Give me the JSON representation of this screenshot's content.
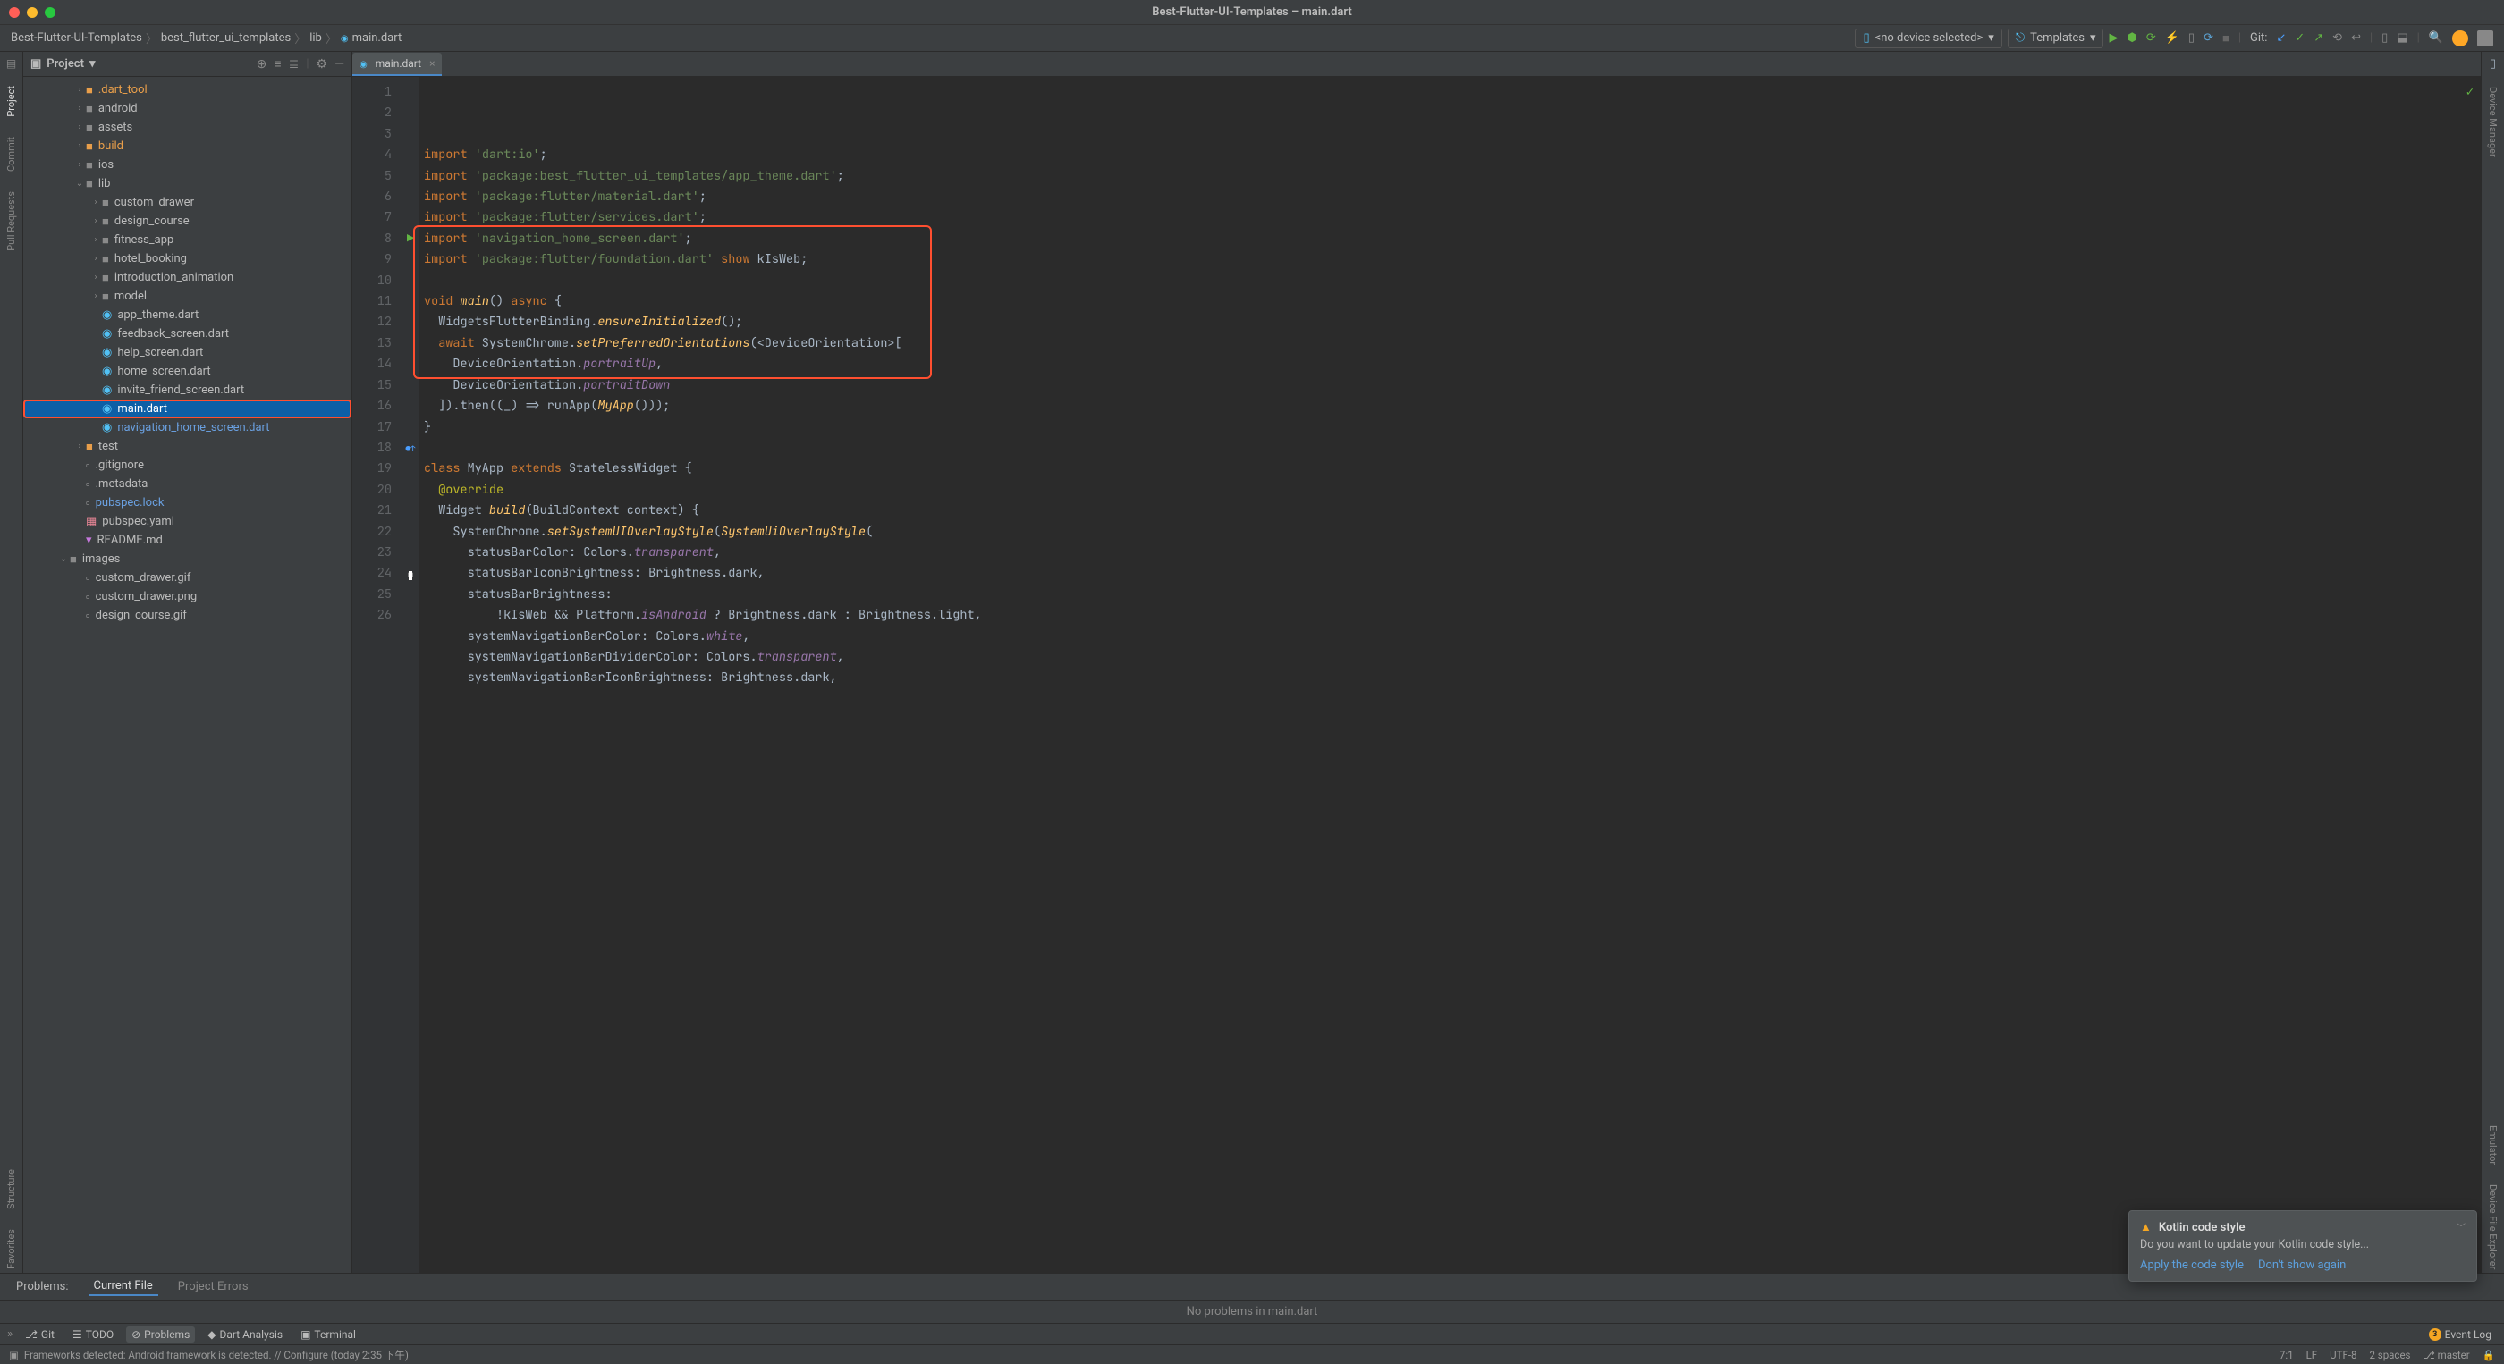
{
  "titlebar": {
    "title": "Best-Flutter-UI-Templates – main.dart"
  },
  "breadcrumb": {
    "items": [
      "Best-Flutter-UI-Templates",
      "best_flutter_ui_templates",
      "lib",
      "main.dart"
    ]
  },
  "device_selector": {
    "label": "<no device selected>"
  },
  "run_config": {
    "label": "Templates"
  },
  "git_label": "Git:",
  "left_tools": {
    "project": "Project",
    "commit": "Commit",
    "pull_requests": "Pull Requests",
    "structure": "Structure",
    "favorites": "Favorites"
  },
  "right_tools": {
    "device_manager": "Device Manager",
    "emulator": "Emulator",
    "device_file_explorer": "Device File Explorer"
  },
  "sidebar": {
    "header": "Project",
    "tree": [
      {
        "depth": 1,
        "chev": ">",
        "icon": "folder",
        "cls": "orange",
        "label": ".dart_tool",
        "lcls": "orange"
      },
      {
        "depth": 1,
        "chev": ">",
        "icon": "folder",
        "label": "android"
      },
      {
        "depth": 1,
        "chev": ">",
        "icon": "folder",
        "label": "assets"
      },
      {
        "depth": 1,
        "chev": ">",
        "icon": "folder",
        "cls": "build",
        "label": "build",
        "lcls": "orange"
      },
      {
        "depth": 1,
        "chev": ">",
        "icon": "folder",
        "label": "ios"
      },
      {
        "depth": 1,
        "chev": "v",
        "icon": "folder",
        "label": "lib"
      },
      {
        "depth": 2,
        "chev": ">",
        "icon": "folder",
        "label": "custom_drawer"
      },
      {
        "depth": 2,
        "chev": ">",
        "icon": "folder",
        "label": "design_course"
      },
      {
        "depth": 2,
        "chev": ">",
        "icon": "folder",
        "label": "fitness_app"
      },
      {
        "depth": 2,
        "chev": ">",
        "icon": "folder",
        "label": "hotel_booking"
      },
      {
        "depth": 2,
        "chev": ">",
        "icon": "folder",
        "label": "introduction_animation"
      },
      {
        "depth": 2,
        "chev": ">",
        "icon": "folder",
        "label": "model"
      },
      {
        "depth": 2,
        "chev": "",
        "icon": "dart",
        "label": "app_theme.dart"
      },
      {
        "depth": 2,
        "chev": "",
        "icon": "dart",
        "label": "feedback_screen.dart"
      },
      {
        "depth": 2,
        "chev": "",
        "icon": "dart",
        "label": "help_screen.dart"
      },
      {
        "depth": 2,
        "chev": "",
        "icon": "dart",
        "label": "home_screen.dart"
      },
      {
        "depth": 2,
        "chev": "",
        "icon": "dart",
        "label": "invite_friend_screen.dart"
      },
      {
        "depth": 2,
        "chev": "",
        "icon": "dart",
        "label": "main.dart",
        "selected": true,
        "hl": true
      },
      {
        "depth": 2,
        "chev": "",
        "icon": "dart",
        "label": "navigation_home_screen.dart",
        "lcls": "blue"
      },
      {
        "depth": 1,
        "chev": ">",
        "icon": "folder",
        "cls": "orange",
        "label": "test"
      },
      {
        "depth": 1,
        "chev": "",
        "icon": "file",
        "label": ".gitignore"
      },
      {
        "depth": 1,
        "chev": "",
        "icon": "file",
        "label": ".metadata"
      },
      {
        "depth": 1,
        "chev": "",
        "icon": "file",
        "label": "pubspec.lock",
        "lcls": "blue"
      },
      {
        "depth": 1,
        "chev": "",
        "icon": "yaml",
        "label": "pubspec.yaml"
      },
      {
        "depth": 1,
        "chev": "",
        "icon": "md",
        "label": "README.md"
      },
      {
        "depth": 0,
        "chev": "v",
        "icon": "folder",
        "label": "images"
      },
      {
        "depth": 1,
        "chev": "",
        "icon": "file",
        "label": "custom_drawer.gif"
      },
      {
        "depth": 1,
        "chev": "",
        "icon": "file",
        "label": "custom_drawer.png"
      },
      {
        "depth": 1,
        "chev": "",
        "icon": "file",
        "label": "design_course.gif"
      }
    ]
  },
  "tab": {
    "label": "main.dart"
  },
  "code_lines": [
    {
      "n": 1,
      "marker": "",
      "html": "<span class='kw'>import</span> <span class='str'>'dart:io'</span>;"
    },
    {
      "n": 2,
      "marker": "",
      "html": "<span class='kw'>import</span> <span class='str'>'package:best_flutter_ui_templates/app_theme.dart'</span>;"
    },
    {
      "n": 3,
      "marker": "",
      "html": "<span class='kw'>import</span> <span class='str'>'package:flutter/material.dart'</span>;"
    },
    {
      "n": 4,
      "marker": "",
      "html": "<span class='kw'>import</span> <span class='str'>'package:flutter/services.dart'</span>;"
    },
    {
      "n": 5,
      "marker": "",
      "html": "<span class='kw'>import</span> <span class='str'>'navigation_home_screen.dart'</span>;"
    },
    {
      "n": 6,
      "marker": "",
      "html": "<span class='kw'>import</span> <span class='str'>'package:flutter/foundation.dart'</span> <span class='kw'>show</span> kIsWeb;"
    },
    {
      "n": 7,
      "marker": "",
      "html": ""
    },
    {
      "n": 8,
      "marker": "▶",
      "html": "<span class='kw'>void</span> <span class='fn'>main</span>() <span class='kw'>async</span> {"
    },
    {
      "n": 9,
      "marker": "",
      "html": "  WidgetsFlutterBinding.<span class='fn-call'>ensureInitialized</span>();"
    },
    {
      "n": 10,
      "marker": "",
      "html": "  <span class='kw'>await</span> SystemChrome.<span class='fn-call'>setPreferredOrientations</span>(&lt;DeviceOrientation&gt;["
    },
    {
      "n": 11,
      "marker": "",
      "html": "    DeviceOrientation.<span class='prop'>portraitUp</span>,"
    },
    {
      "n": 12,
      "marker": "",
      "html": "    DeviceOrientation.<span class='prop'>portraitDown</span>"
    },
    {
      "n": 13,
      "marker": "",
      "html": "  ]).then((_) =&gt; runApp(<span class='fn'>MyApp</span>()));"
    },
    {
      "n": 14,
      "marker": "",
      "html": "}"
    },
    {
      "n": 15,
      "marker": "",
      "html": ""
    },
    {
      "n": 16,
      "marker": "",
      "html": "<span class='kw'>class</span> MyApp <span class='kw'>extends</span> StatelessWidget {"
    },
    {
      "n": 17,
      "marker": "",
      "html": "  <span class='ann'>@override</span>"
    },
    {
      "n": 18,
      "marker": "●",
      "html": "  Widget <span class='fn'>build</span>(BuildContext context) {"
    },
    {
      "n": 19,
      "marker": "",
      "html": "    SystemChrome.<span class='fn-call'>setSystemUIOverlayStyle</span>(<span class='fn'>SystemUiOverlayStyle</span>("
    },
    {
      "n": 20,
      "marker": "",
      "html": "      statusBarColor: Colors.<span class='prop'>transparent</span>,"
    },
    {
      "n": 21,
      "marker": "",
      "html": "      statusBarIconBrightness: Brightness.dark,"
    },
    {
      "n": 22,
      "marker": "",
      "html": "      statusBarBrightness:"
    },
    {
      "n": 23,
      "marker": "",
      "html": "          !kIsWeb && Platform.<span class='prop'>isAndroid</span> ? Brightness.dark : Brightness.light,"
    },
    {
      "n": 24,
      "marker": "■",
      "html": "      systemNavigationBarColor: Colors.<span class='prop'>white</span>,"
    },
    {
      "n": 25,
      "marker": "",
      "html": "      systemNavigationBarDividerColor: Colors.<span class='prop'>transparent</span>,"
    },
    {
      "n": 26,
      "marker": "",
      "html": "      systemNavigationBarIconBrightness: Brightness.dark,"
    }
  ],
  "code_redbox": {
    "top_line": 8,
    "bottom_line": 14
  },
  "problems": {
    "label": "Problems:",
    "tabs": [
      "Current File",
      "Project Errors"
    ],
    "body": "No problems in main.dart"
  },
  "notification": {
    "title": "Kotlin code style",
    "body": "Do you want to update your Kotlin code style...",
    "actions": [
      "Apply the code style",
      "Don't show again"
    ]
  },
  "bottom_tools": {
    "git": "Git",
    "todo": "TODO",
    "problems": "Problems",
    "dart": "Dart Analysis",
    "terminal": "Terminal",
    "event_log": "Event Log",
    "event_badge": "3"
  },
  "status": {
    "message": "Frameworks detected: Android framework is detected. // Configure (today 2:35 下午)",
    "caret": "7:1",
    "lf": "LF",
    "encoding": "UTF-8",
    "indent": "2 spaces",
    "branch": "master"
  }
}
